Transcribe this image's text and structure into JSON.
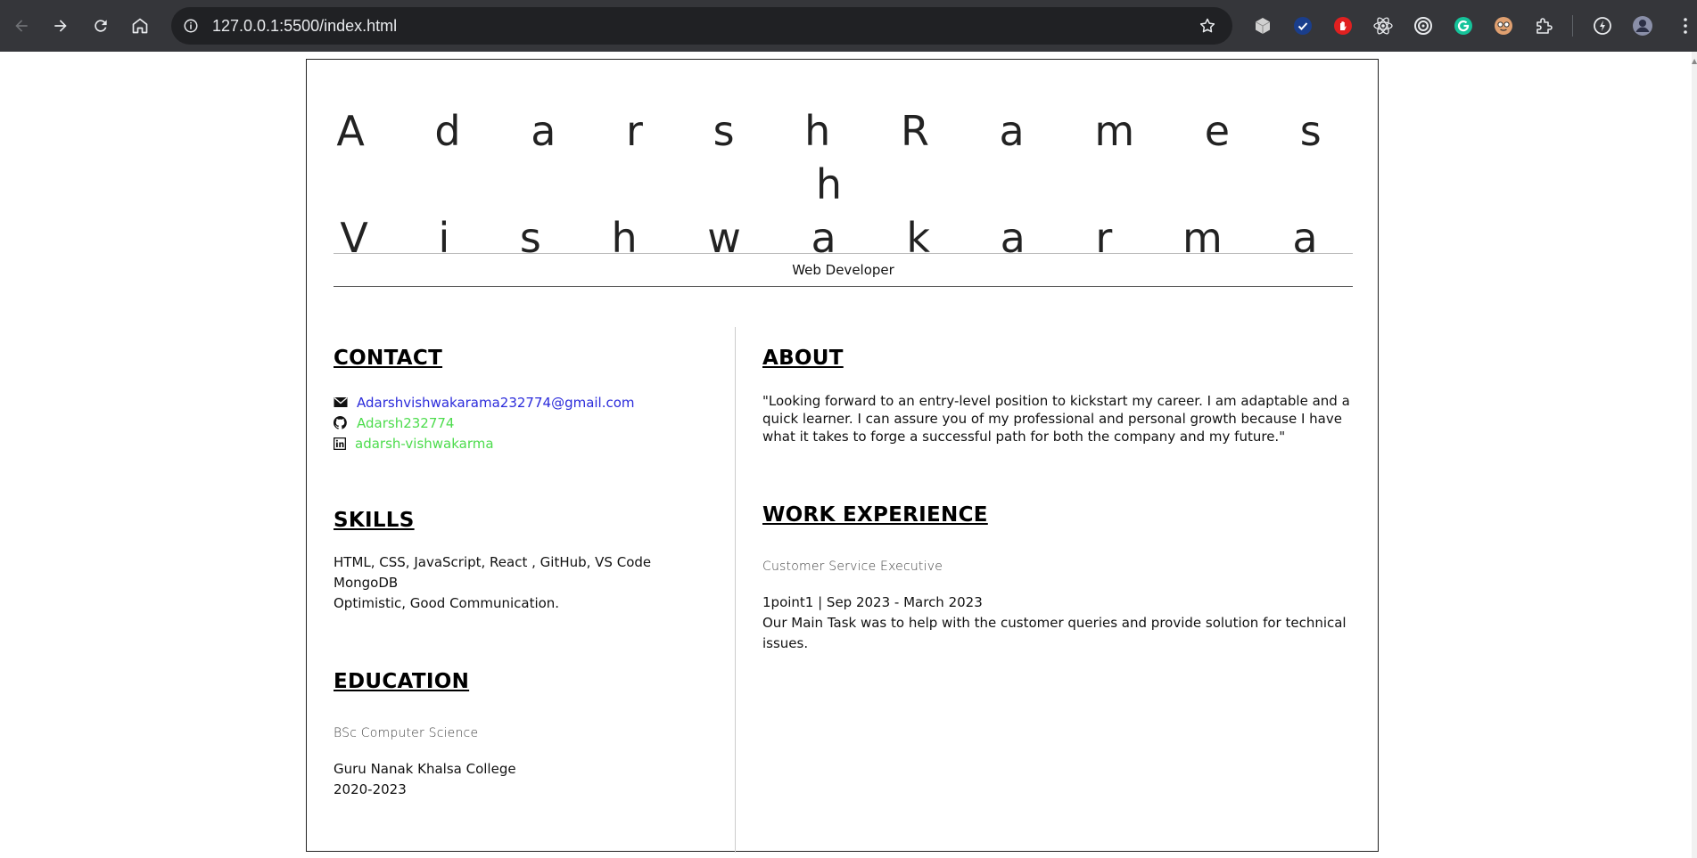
{
  "browser": {
    "url": "127.0.0.1:5500/index.html",
    "chrome_color": "#35363a",
    "extensions": [
      "cube-extension-icon",
      "check-extension-icon",
      "stop-hand-extension-icon",
      "react-devtools-icon",
      "target-extension-icon",
      "grammarly-icon",
      "face-extension-icon",
      "puzzle-extensions-icon",
      "performance-icon",
      "profile-avatar-icon"
    ]
  },
  "resume": {
    "name_line1": "A d a r s h   R a m e s h",
    "name_line2": "V i s h w a k a r m a",
    "role": "Web Developer",
    "contact": {
      "heading": "CONTACT",
      "email": "Adarshvishwakarama232774@gmail.com",
      "github": "Adarsh232774",
      "linkedin": "adarsh-vishwakarma"
    },
    "skills": {
      "heading": "SKILLS",
      "lines": [
        "HTML, CSS, JavaScript, React , GitHub, VS Code",
        "MongoDB",
        "Optimistic, Good Communication."
      ]
    },
    "education": {
      "heading": "EDUCATION",
      "degree": "BSc Computer Science",
      "college": "Guru Nanak Khalsa College",
      "years": "2020-2023"
    },
    "about": {
      "heading": "ABOUT",
      "text": "\"Looking forward to an entry-level position to kickstart my career. I am adaptable and a quick learner. I can assure you of my professional and personal growth because I have what it takes to forge a successful path for both the company and my future.\""
    },
    "work": {
      "heading": "WORK EXPERIENCE",
      "position": "Customer Service Executive",
      "company_dates": "1point1 | Sep 2023 - March 2023",
      "description": "Our Main Task was to help with the customer queries and provide solution for technical issues."
    }
  },
  "colors": {
    "email_link": "#2b2bdb",
    "social_link": "#4ddc4d",
    "border": "#222222"
  }
}
